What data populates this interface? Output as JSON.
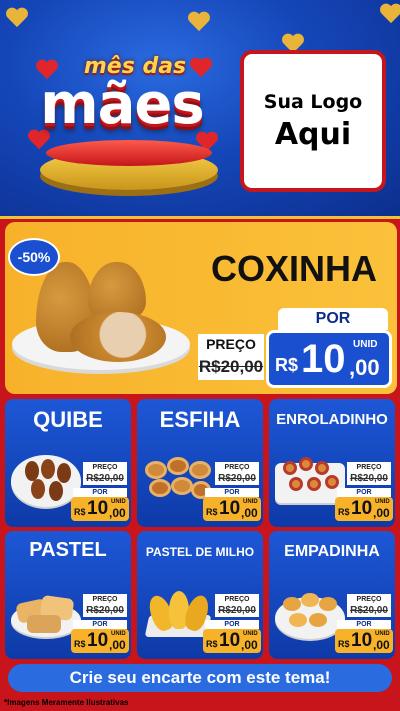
{
  "header": {
    "title_small": "mês das",
    "title_big": "mães",
    "logo_line1": "Sua Logo",
    "logo_line2": "Aqui"
  },
  "featured": {
    "discount": "-50%",
    "name": "COXINHA",
    "preco_label": "PREÇO",
    "old_price": "R$20,00",
    "por_label": "POR",
    "currency": "R$",
    "price_int": "10",
    "price_dec": ",00",
    "unit": "UNID"
  },
  "cards": [
    {
      "name": "QUIBE",
      "preco_label": "PREÇO",
      "old_price": "R$20,00",
      "por_label": "POR",
      "currency": "R$",
      "price_int": "10",
      "price_dec": ",00",
      "unit": "UNID"
    },
    {
      "name": "ESFIHA",
      "preco_label": "PREÇO",
      "old_price": "R$20,00",
      "por_label": "POR",
      "currency": "R$",
      "price_int": "10",
      "price_dec": ",00",
      "unit": "UNID"
    },
    {
      "name": "ENROLADINHO",
      "preco_label": "PREÇO",
      "old_price": "R$20,00",
      "por_label": "POR",
      "currency": "R$",
      "price_int": "10",
      "price_dec": ",00",
      "unit": "UNID"
    },
    {
      "name": "PASTEL",
      "preco_label": "PREÇO",
      "old_price": "R$20,00",
      "por_label": "POR",
      "currency": "R$",
      "price_int": "10",
      "price_dec": ",00",
      "unit": "UNID"
    },
    {
      "name": "PASTEL DE MILHO",
      "preco_label": "PREÇO",
      "old_price": "R$20,00",
      "por_label": "POR",
      "currency": "R$",
      "price_int": "10",
      "price_dec": ",00",
      "unit": "UNID"
    },
    {
      "name": "EMPADINHA",
      "preco_label": "PREÇO",
      "old_price": "R$20,00",
      "por_label": "POR",
      "currency": "R$",
      "price_int": "10",
      "price_dec": ",00",
      "unit": "UNID"
    }
  ],
  "cta": "Crie seu encarte com este tema!",
  "disclaimer": "*Imagens Meramente Ilustrativas",
  "colors": {
    "header_blue": "#1546b8",
    "panel_red": "#c8141b",
    "featured_yellow": "#f7b22a",
    "card_blue": "#1d57d6",
    "price_badge": "#f7b22a"
  }
}
